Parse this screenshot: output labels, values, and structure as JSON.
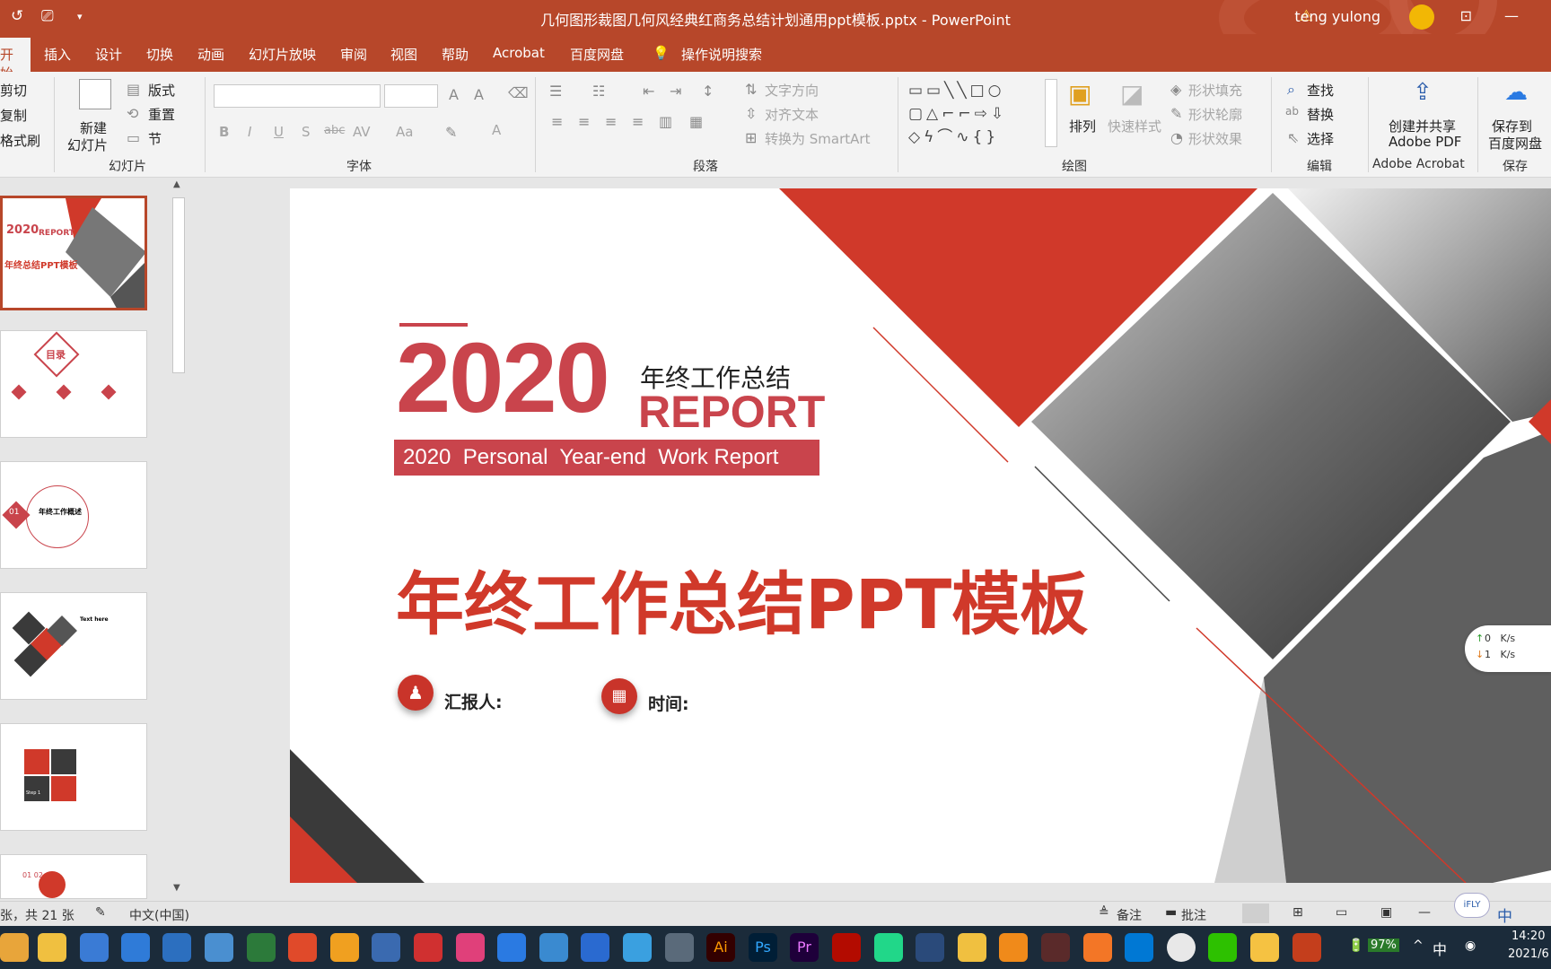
{
  "titlebar": {
    "doc_title": "几何图形裁图几何风经典红商务总结计划通用ppt模板.pptx  -  PowerPoint",
    "user": "teng yulong",
    "quick_access": [
      "undo-icon",
      "present-icon",
      "customize-icon"
    ]
  },
  "tabs": [
    "开始",
    "插入",
    "设计",
    "切换",
    "动画",
    "幻灯片放映",
    "审阅",
    "视图",
    "帮助",
    "Acrobat",
    "百度网盘"
  ],
  "tell_me": "操作说明搜索",
  "ribbon": {
    "clipboard": {
      "cut": "剪切",
      "copy": "复制",
      "format_painter": "格式刷"
    },
    "slides": {
      "new_slide_1": "新建",
      "new_slide_2": "幻灯片",
      "layout": "版式",
      "reset": "重置",
      "section": "节",
      "group": "幻灯片"
    },
    "font": {
      "group": "字体",
      "bold": "B",
      "italic": "I",
      "underline": "U",
      "shadow": "S",
      "strike": "abc",
      "spacing": "AV",
      "case": "Aa",
      "color": "A"
    },
    "paragraph": {
      "group": "段落",
      "text_direction": "文字方向",
      "align_text": "对齐文本",
      "smartart": "转换为 SmartArt"
    },
    "drawing": {
      "group": "绘图",
      "arrange": "排列",
      "quick_styles": "快速样式",
      "fill": "形状填充",
      "outline": "形状轮廓",
      "effects": "形状效果"
    },
    "editing": {
      "group": "编辑",
      "find": "查找",
      "replace": "替换",
      "select": "选择"
    },
    "acrobat": {
      "create_1": "创建并共享",
      "create_2": "Adobe PDF",
      "group": "Adobe Acrobat"
    },
    "save": {
      "save_1": "保存到",
      "save_2": "百度网盘",
      "group": "保存"
    }
  },
  "thumbnails": [
    {
      "label": "年终总结PPT模板",
      "year": "2020",
      "report": "REPORT"
    },
    {
      "label": "目录"
    },
    {
      "label": "年终工作概述",
      "num": "01"
    },
    {
      "label": "Text here"
    },
    {
      "label": "Step 1"
    },
    {
      "label": "01 02"
    }
  ],
  "slide": {
    "year": "2020",
    "subtitle_cn": "年终工作总结",
    "report": "REPORT",
    "banner": "2020  Personal  Year-end  Work Report",
    "main_title": "年终工作总结PPT模板",
    "reporter_label": "汇报人:",
    "time_label": "时间:"
  },
  "net_speed": {
    "up": "0   K/s",
    "down": "1   K/s"
  },
  "status": {
    "slide_info": "张，共 21 张",
    "language": "中文(中国)",
    "notes": "备注",
    "comments": "批注"
  },
  "taskbar": {
    "battery": "97%",
    "ime": "中",
    "time": "14:20",
    "date": "2021/6"
  },
  "colors": {
    "accent": "#b7472a",
    "slide_red": "#d0392a",
    "banner": "#c9444c",
    "taskbar": "#1b2b3a"
  }
}
